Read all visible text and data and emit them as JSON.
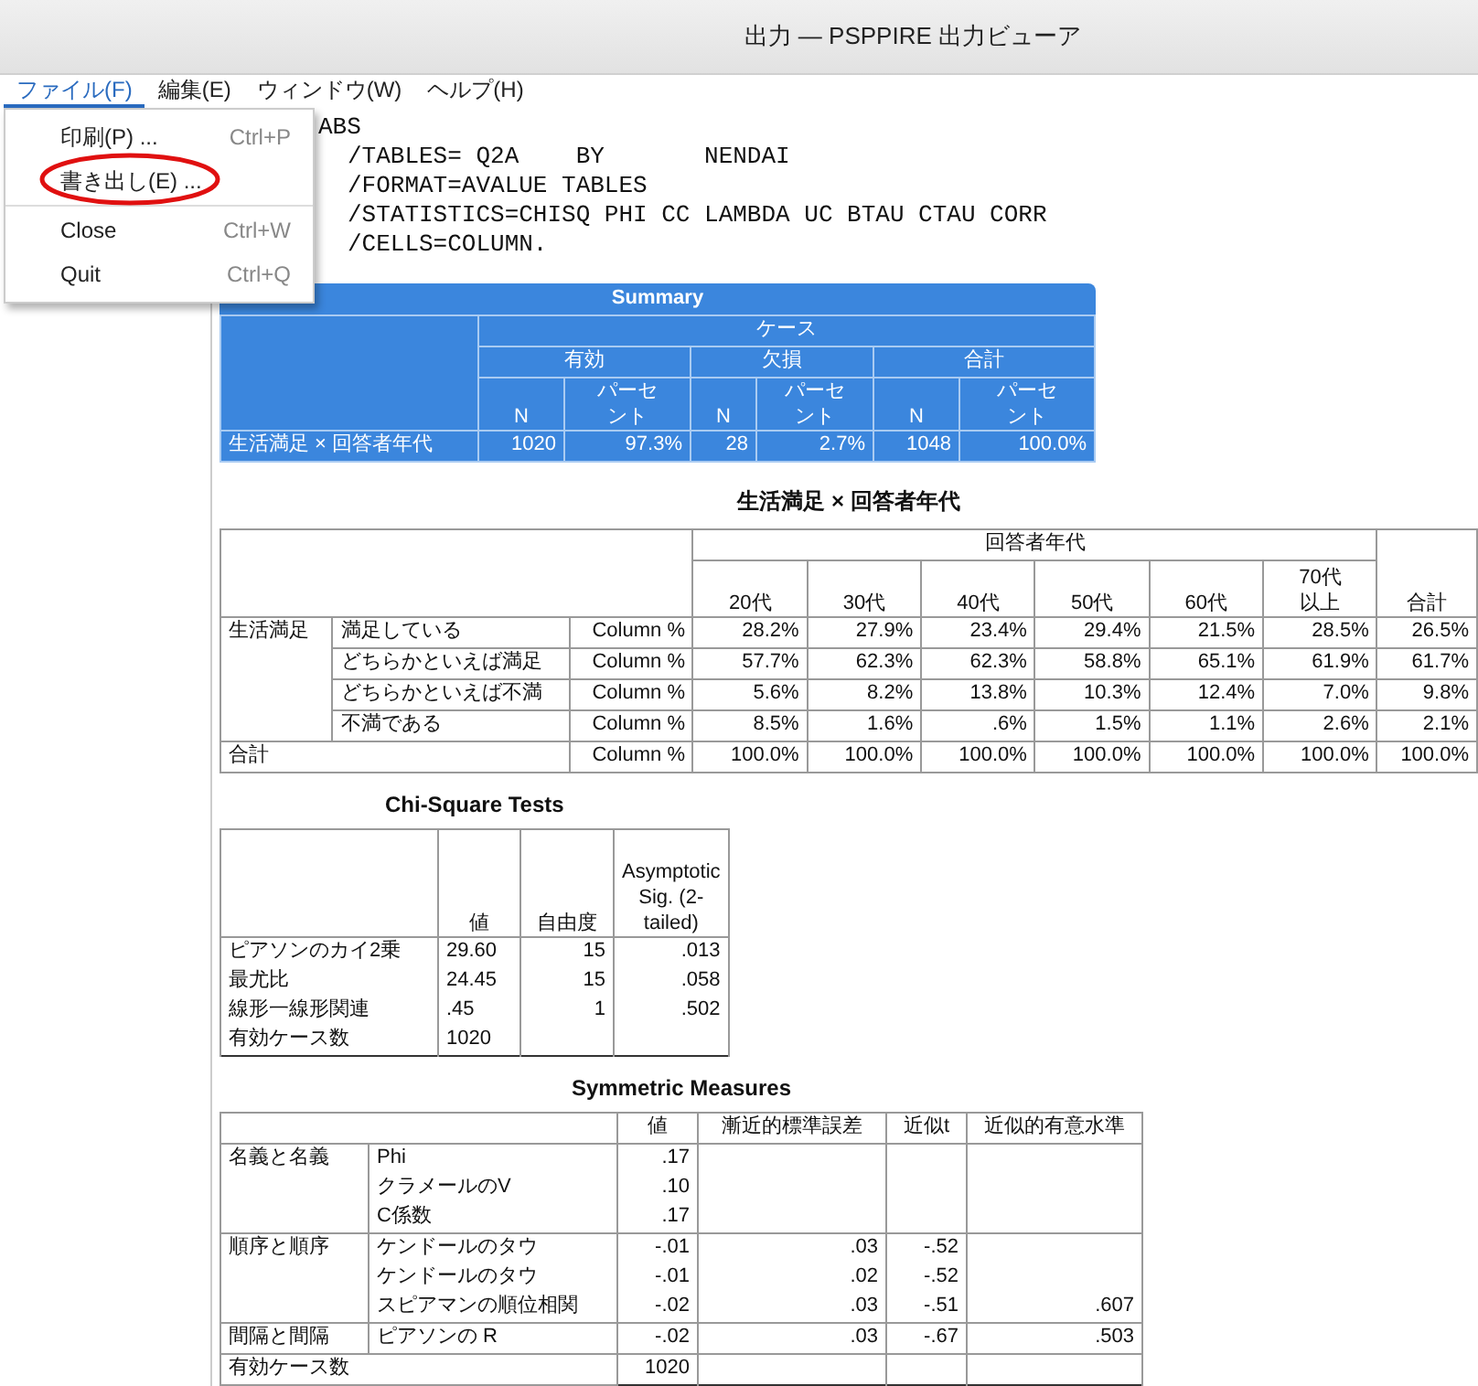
{
  "window": {
    "title": "出力 — PSPPIRE 出力ビューア"
  },
  "menu": [
    {
      "label": "ファイル(F)",
      "selected": true
    },
    {
      "label": "編集(E)",
      "selected": false
    },
    {
      "label": "ウィンドウ(W)",
      "selected": false
    },
    {
      "label": "ヘルプ(H)",
      "selected": false
    }
  ],
  "file_menu": {
    "groups": [
      [
        {
          "label": "印刷(P) ...",
          "shortcut": "Ctrl+P",
          "circled": false
        },
        {
          "label": "書き出し(E) ...",
          "circled": true
        }
      ],
      [
        {
          "label": "Close",
          "shortcut": "Ctrl+W",
          "circled": false
        },
        {
          "label": "Quit",
          "shortcut": "Ctrl+Q",
          "circled": false
        }
      ]
    ]
  },
  "syntax": [
    "ABS",
    "/TABLES= Q2A    BY       NENDAI",
    "/FORMAT=AVALUE TABLES",
    "/STATISTICS=CHISQ PHI CC LAMBDA UC BTAU CTAU CORR",
    "/CELLS=COLUMN."
  ],
  "summary": {
    "title": "Summary",
    "cases_label": "ケース",
    "groups": [
      "有効",
      "欠損",
      "合計"
    ],
    "subheaders": [
      "N",
      "パーセント",
      "N",
      "パーセント",
      "N",
      "パーセント"
    ],
    "rows": [
      {
        "label": "生活満足 × 回答者年代",
        "cells": [
          "1020",
          "97.3%",
          "28",
          "2.7%",
          "1048",
          "100.0%"
        ]
      }
    ]
  },
  "crosstab": {
    "title": "生活満足 × 回答者年代",
    "column_variable": "回答者年代",
    "columns": [
      "20代",
      "30代",
      "40代",
      "50代",
      "60代",
      "70代以上"
    ],
    "total_label": "合計",
    "row_variable": "生活満足",
    "rows": [
      {
        "label": "満足している",
        "stat": "Column %",
        "values": [
          "28.2%",
          "27.9%",
          "23.4%",
          "29.4%",
          "21.5%",
          "28.5%",
          "26.5%"
        ]
      },
      {
        "label": "どちらかといえば満足",
        "stat": "Column %",
        "values": [
          "57.7%",
          "62.3%",
          "62.3%",
          "58.8%",
          "65.1%",
          "61.9%",
          "61.7%"
        ]
      },
      {
        "label": "どちらかといえば不満",
        "stat": "Column %",
        "values": [
          "5.6%",
          "8.2%",
          "13.8%",
          "10.3%",
          "12.4%",
          "7.0%",
          "9.8%"
        ]
      },
      {
        "label": "不満である",
        "stat": "Column %",
        "values": [
          "8.5%",
          "1.6%",
          ".6%",
          "1.5%",
          "1.1%",
          "2.6%",
          "2.1%"
        ]
      }
    ],
    "total_row": {
      "label": "合計",
      "stat": "Column %",
      "values": [
        "100.0%",
        "100.0%",
        "100.0%",
        "100.0%",
        "100.0%",
        "100.0%",
        "100.0%"
      ]
    }
  },
  "chi_square": {
    "title": "Chi-Square Tests",
    "columns": [
      "値",
      "自由度",
      "Asymptotic Sig. (2-tailed)"
    ],
    "rows": [
      {
        "label": "ピアソンのカイ2乗",
        "values": [
          "29.60",
          "15",
          ".013"
        ]
      },
      {
        "label": "最尤比",
        "values": [
          "24.45",
          "15",
          ".058"
        ]
      },
      {
        "label": "線形一線形関連",
        "values": [
          ".45",
          "1",
          ".502"
        ]
      },
      {
        "label": "有効ケース数",
        "values": [
          "1020"
        ]
      }
    ]
  },
  "symmetric": {
    "title": "Symmetric Measures",
    "columns": [
      "値",
      "漸近的標準誤差",
      "近似t",
      "近似的有意水準"
    ],
    "groups": [
      {
        "label": "名義と名義",
        "rows": [
          {
            "label": "Phi",
            "values": [
              ".17"
            ]
          },
          {
            "label": "クラメールのV",
            "values": [
              ".10"
            ]
          },
          {
            "label": "C係数",
            "values": [
              ".17"
            ]
          }
        ]
      },
      {
        "label": "順序と順序",
        "rows": [
          {
            "label": "ケンドールのタウ",
            "values": [
              "-.01",
              ".03",
              "-.52"
            ]
          },
          {
            "label": "ケンドールのタウ",
            "values": [
              "-.01",
              ".02",
              "-.52"
            ]
          },
          {
            "label": "スピアマンの順位相関",
            "values": [
              "-.02",
              ".03",
              "-.51",
              ".607"
            ]
          }
        ]
      },
      {
        "label": "間隔と間隔",
        "rows": [
          {
            "label": "ピアソンの R",
            "values": [
              "-.02",
              ".03",
              "-.67",
              ".503"
            ]
          }
        ]
      }
    ],
    "total_row": {
      "label": "有効ケース数",
      "values": [
        "1020"
      ]
    }
  }
}
